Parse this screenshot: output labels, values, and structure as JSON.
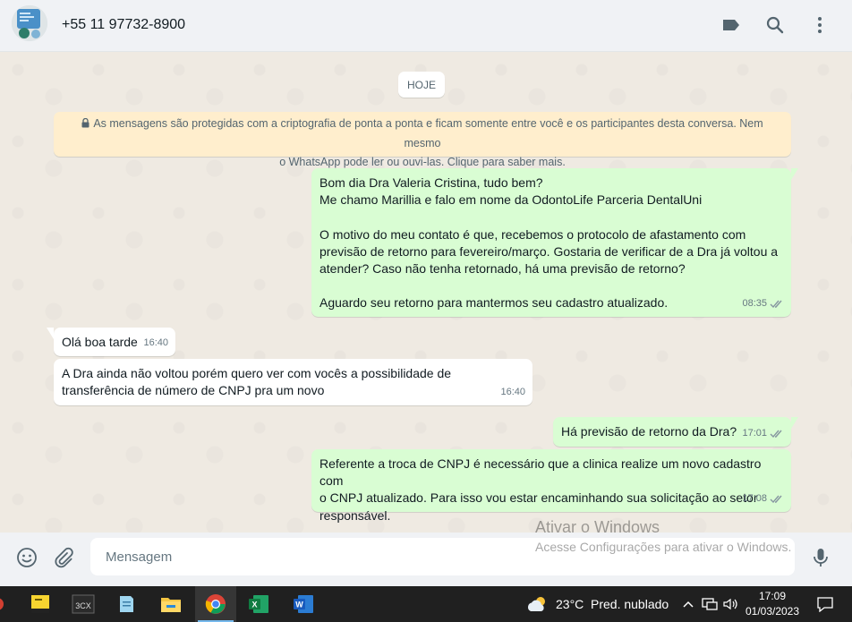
{
  "header": {
    "contact_name": "+55 11 97732-8900",
    "icons": [
      "label-icon",
      "search-icon",
      "more-options-icon"
    ]
  },
  "chat": {
    "date_chip": "HOJE",
    "encryption_notice_line1": "As mensagens são protegidas com a criptografia de ponta a ponta e ficam somente entre você e os participantes desta conversa. Nem mesmo",
    "encryption_notice_line2": "o WhatsApp pode ler ou ouvi-las. Clique para saber mais.",
    "messages": [
      {
        "direction": "outgoing",
        "text": "Bom dia Dra Valeria Cristina, tudo bem?\nMe chamo Marillia e falo em nome da OdontoLife Parceria DentalUni\n\nO motivo do meu contato é que, recebemos o protocolo de afastamento com\nprevisão de retorno para fevereiro/março. Gostaria de verificar de a Dra já voltou a\natender? Caso não tenha retornado, há uma previsão de retorno?\n\nAguardo seu retorno para mantermos seu cadastro atualizado.",
        "time": "08:35",
        "status": "read"
      },
      {
        "direction": "incoming",
        "text": "Olá boa tarde",
        "time": "16:40"
      },
      {
        "direction": "incoming",
        "text": "A Dra ainda não voltou porém quero ver com vocês a possibilidade de\ntransferência de número de CNPJ pra um novo",
        "time": "16:40"
      },
      {
        "direction": "outgoing",
        "text": "Há previsão de retorno da Dra?",
        "time": "17:01",
        "status": "read"
      },
      {
        "direction": "outgoing",
        "text": "Referente a troca de CNPJ é necessário que a clinica realize um novo cadastro com\no CNPJ atualizado. Para isso vou estar encaminhando sua solicitação ao setor\nresponsável.",
        "time": "17:08",
        "status": "read"
      }
    ]
  },
  "composer": {
    "placeholder": "Mensagem",
    "icons": [
      "emoji-icon",
      "attach-icon",
      "microphone-icon"
    ]
  },
  "watermark": {
    "line1": "Ativar o Windows",
    "line2": "Acesse Configurações para ativar o Windows."
  },
  "taskbar": {
    "apps": [
      "sticky-notes-icon",
      "3cx-icon",
      "notepad-icon",
      "file-explorer-icon",
      "chrome-icon",
      "excel-icon",
      "word-icon"
    ],
    "weather_temp": "23°C",
    "weather_desc": "Pred. nublado",
    "clock_time": "17:09",
    "clock_date": "01/03/2023"
  },
  "colors": {
    "outgoing_bubble": "#d9fdd3",
    "incoming_bubble": "#ffffff",
    "chat_background": "#efeae2",
    "encryption_banner": "#ffeecd"
  }
}
